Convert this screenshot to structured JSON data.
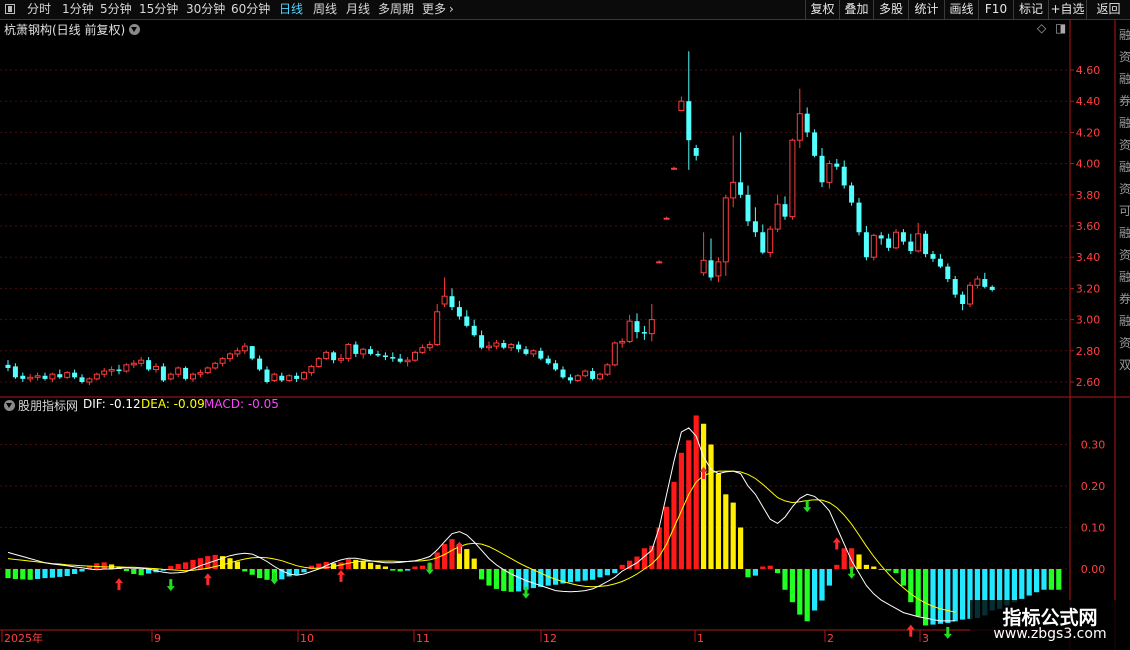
{
  "toolbar": {
    "periods": [
      "分时",
      "1分钟",
      "5分钟",
      "15分钟",
      "30分钟",
      "60分钟",
      "日线",
      "周线",
      "月线",
      "多周期",
      "更多"
    ],
    "active_period": "日线",
    "right_buttons": [
      "复权",
      "叠加",
      "多股",
      "统计",
      "画线",
      "F10",
      "标记",
      "+自选",
      "返回"
    ]
  },
  "main_panel": {
    "title": "杭萧钢构(日线 前复权)",
    "price_ticks": [
      "4.60",
      "4.40",
      "4.20",
      "4.00",
      "3.80",
      "3.60",
      "3.40",
      "3.20",
      "3.00",
      "2.80",
      "2.60"
    ]
  },
  "indicator_panel": {
    "name": "股朋指标网",
    "dif_label": "DIF: -0.12",
    "dea_label": "DEA: -0.09",
    "macd_label": "MACD: -0.05",
    "ticks": [
      "0.30",
      "0.20",
      "0.10",
      "0.00"
    ]
  },
  "x_axis": {
    "labels": [
      "2025年",
      "9",
      "10",
      "11",
      "12",
      "1",
      "2",
      "3"
    ]
  },
  "side_text": [
    "融",
    "资",
    "融",
    "券",
    "融",
    "资",
    "融",
    "资",
    "可",
    "融",
    "资",
    "融",
    "券",
    "融",
    "资",
    "双"
  ],
  "watermark": {
    "title": "指标公式网",
    "url": "www.zbgs3.com"
  },
  "colors": {
    "up": "#ff3c3c",
    "down": "#54ffff",
    "axis": "#b01818",
    "grid": "#4a0e0e",
    "dif": "#ffffff",
    "dea": "#ffff00",
    "macd": "#ff44ff",
    "active": "#4fd4ff"
  },
  "chart_data": {
    "type": "candlestick",
    "title": "杭萧钢构(日线 前复权)",
    "ylim": [
      2.5,
      4.75
    ],
    "candles": [
      [
        2.71,
        2.74,
        2.67,
        2.69
      ],
      [
        2.7,
        2.72,
        2.62,
        2.63
      ],
      [
        2.64,
        2.66,
        2.6,
        2.62
      ],
      [
        2.62,
        2.65,
        2.6,
        2.63
      ],
      [
        2.63,
        2.66,
        2.61,
        2.64
      ],
      [
        2.64,
        2.66,
        2.61,
        2.62
      ],
      [
        2.62,
        2.66,
        2.6,
        2.65
      ],
      [
        2.65,
        2.68,
        2.62,
        2.63
      ],
      [
        2.63,
        2.67,
        2.62,
        2.66
      ],
      [
        2.66,
        2.68,
        2.62,
        2.63
      ],
      [
        2.63,
        2.65,
        2.59,
        2.6
      ],
      [
        2.6,
        2.63,
        2.58,
        2.62
      ],
      [
        2.62,
        2.66,
        2.61,
        2.65
      ],
      [
        2.65,
        2.69,
        2.63,
        2.67
      ],
      [
        2.67,
        2.7,
        2.64,
        2.68
      ],
      [
        2.68,
        2.71,
        2.65,
        2.67
      ],
      [
        2.67,
        2.72,
        2.66,
        2.71
      ],
      [
        2.71,
        2.74,
        2.69,
        2.72
      ],
      [
        2.72,
        2.76,
        2.7,
        2.74
      ],
      [
        2.74,
        2.76,
        2.67,
        2.68
      ],
      [
        2.68,
        2.72,
        2.66,
        2.7
      ],
      [
        2.7,
        2.72,
        2.6,
        2.61
      ],
      [
        2.62,
        2.66,
        2.61,
        2.65
      ],
      [
        2.65,
        2.7,
        2.63,
        2.69
      ],
      [
        2.69,
        2.7,
        2.61,
        2.62
      ],
      [
        2.62,
        2.66,
        2.6,
        2.65
      ],
      [
        2.65,
        2.68,
        2.63,
        2.66
      ],
      [
        2.66,
        2.7,
        2.65,
        2.69
      ],
      [
        2.69,
        2.73,
        2.68,
        2.72
      ],
      [
        2.72,
        2.76,
        2.7,
        2.75
      ],
      [
        2.75,
        2.79,
        2.73,
        2.78
      ],
      [
        2.78,
        2.82,
        2.76,
        2.8
      ],
      [
        2.8,
        2.85,
        2.78,
        2.83
      ],
      [
        2.83,
        2.83,
        2.74,
        2.75
      ],
      [
        2.75,
        2.77,
        2.67,
        2.68
      ],
      [
        2.68,
        2.7,
        2.59,
        2.6
      ],
      [
        2.61,
        2.66,
        2.6,
        2.65
      ],
      [
        2.64,
        2.66,
        2.6,
        2.61
      ],
      [
        2.61,
        2.65,
        2.6,
        2.64
      ],
      [
        2.64,
        2.66,
        2.6,
        2.62
      ],
      [
        2.62,
        2.67,
        2.61,
        2.66
      ],
      [
        2.66,
        2.71,
        2.64,
        2.7
      ],
      [
        2.7,
        2.76,
        2.69,
        2.75
      ],
      [
        2.75,
        2.8,
        2.74,
        2.79
      ],
      [
        2.79,
        2.8,
        2.72,
        2.74
      ],
      [
        2.74,
        2.78,
        2.72,
        2.75
      ],
      [
        2.75,
        2.85,
        2.73,
        2.84
      ],
      [
        2.84,
        2.86,
        2.76,
        2.78
      ],
      [
        2.78,
        2.82,
        2.75,
        2.81
      ],
      [
        2.81,
        2.83,
        2.77,
        2.78
      ],
      [
        2.78,
        2.8,
        2.76,
        2.77
      ],
      [
        2.77,
        2.79,
        2.74,
        2.76
      ],
      [
        2.76,
        2.79,
        2.73,
        2.75
      ],
      [
        2.75,
        2.78,
        2.72,
        2.73
      ],
      [
        2.73,
        2.76,
        2.7,
        2.74
      ],
      [
        2.74,
        2.8,
        2.73,
        2.79
      ],
      [
        2.79,
        2.84,
        2.78,
        2.82
      ],
      [
        2.82,
        2.86,
        2.8,
        2.84
      ],
      [
        2.84,
        3.1,
        2.83,
        3.05
      ],
      [
        3.1,
        3.27,
        3.08,
        3.15
      ],
      [
        3.15,
        3.2,
        3.06,
        3.08
      ],
      [
        3.08,
        3.12,
        3.0,
        3.02
      ],
      [
        3.02,
        3.06,
        2.95,
        2.96
      ],
      [
        2.96,
        3.0,
        2.89,
        2.9
      ],
      [
        2.9,
        2.93,
        2.81,
        2.82
      ],
      [
        2.82,
        2.86,
        2.8,
        2.83
      ],
      [
        2.83,
        2.87,
        2.81,
        2.85
      ],
      [
        2.85,
        2.87,
        2.81,
        2.82
      ],
      [
        2.82,
        2.85,
        2.8,
        2.84
      ],
      [
        2.84,
        2.86,
        2.79,
        2.81
      ],
      [
        2.81,
        2.83,
        2.77,
        2.78
      ],
      [
        2.78,
        2.81,
        2.76,
        2.8
      ],
      [
        2.8,
        2.82,
        2.74,
        2.75
      ],
      [
        2.75,
        2.77,
        2.71,
        2.72
      ],
      [
        2.72,
        2.74,
        2.67,
        2.68
      ],
      [
        2.68,
        2.7,
        2.62,
        2.63
      ],
      [
        2.63,
        2.65,
        2.59,
        2.61
      ],
      [
        2.61,
        2.65,
        2.6,
        2.64
      ],
      [
        2.64,
        2.68,
        2.63,
        2.67
      ],
      [
        2.67,
        2.69,
        2.61,
        2.62
      ],
      [
        2.62,
        2.66,
        2.61,
        2.65
      ],
      [
        2.65,
        2.72,
        2.64,
        2.71
      ],
      [
        2.71,
        2.86,
        2.7,
        2.85
      ],
      [
        2.85,
        2.88,
        2.82,
        2.86
      ],
      [
        2.86,
        3.03,
        2.85,
        2.99
      ],
      [
        2.99,
        3.04,
        2.88,
        2.92
      ],
      [
        2.92,
        2.96,
        2.87,
        2.91
      ],
      [
        2.91,
        3.1,
        2.86,
        3.0
      ],
      [
        3.37,
        3.38,
        3.36,
        3.37
      ],
      [
        3.65,
        3.66,
        3.64,
        3.65
      ],
      [
        3.97,
        3.98,
        3.96,
        3.97
      ],
      [
        4.34,
        4.43,
        4.34,
        4.4
      ],
      [
        4.4,
        4.72,
        3.96,
        4.15
      ],
      [
        4.1,
        4.12,
        4.02,
        4.05
      ],
      [
        3.3,
        3.56,
        3.28,
        3.38
      ],
      [
        3.38,
        3.52,
        3.25,
        3.27
      ],
      [
        3.28,
        3.4,
        3.24,
        3.37
      ],
      [
        3.37,
        3.8,
        3.28,
        3.78
      ],
      [
        3.78,
        4.18,
        3.72,
        3.88
      ],
      [
        3.88,
        4.2,
        3.78,
        3.8
      ],
      [
        3.8,
        3.86,
        3.6,
        3.63
      ],
      [
        3.63,
        3.72,
        3.53,
        3.56
      ],
      [
        3.56,
        3.61,
        3.42,
        3.43
      ],
      [
        3.43,
        3.6,
        3.4,
        3.58
      ],
      [
        3.58,
        3.8,
        3.56,
        3.74
      ],
      [
        3.74,
        3.79,
        3.64,
        3.66
      ],
      [
        3.66,
        4.16,
        3.64,
        4.15
      ],
      [
        4.15,
        4.48,
        4.1,
        4.32
      ],
      [
        4.32,
        4.36,
        4.17,
        4.2
      ],
      [
        4.2,
        4.22,
        4.04,
        4.05
      ],
      [
        4.05,
        4.1,
        3.85,
        3.88
      ],
      [
        3.88,
        4.02,
        3.84,
        4.0
      ],
      [
        4.0,
        4.03,
        3.96,
        3.98
      ],
      [
        3.98,
        4.02,
        3.84,
        3.86
      ],
      [
        3.86,
        3.88,
        3.73,
        3.75
      ],
      [
        3.75,
        3.78,
        3.54,
        3.56
      ],
      [
        3.56,
        3.6,
        3.38,
        3.4
      ],
      [
        3.4,
        3.55,
        3.38,
        3.54
      ],
      [
        3.54,
        3.56,
        3.48,
        3.52
      ],
      [
        3.52,
        3.55,
        3.44,
        3.46
      ],
      [
        3.46,
        3.58,
        3.45,
        3.56
      ],
      [
        3.56,
        3.58,
        3.48,
        3.5
      ],
      [
        3.5,
        3.55,
        3.42,
        3.44
      ],
      [
        3.44,
        3.62,
        3.43,
        3.55
      ],
      [
        3.55,
        3.57,
        3.4,
        3.42
      ],
      [
        3.42,
        3.44,
        3.37,
        3.39
      ],
      [
        3.39,
        3.42,
        3.33,
        3.34
      ],
      [
        3.34,
        3.36,
        3.24,
        3.26
      ],
      [
        3.26,
        3.28,
        3.14,
        3.16
      ],
      [
        3.16,
        3.18,
        3.06,
        3.1
      ],
      [
        3.1,
        3.24,
        3.08,
        3.22
      ],
      [
        3.22,
        3.28,
        3.2,
        3.26
      ],
      [
        3.26,
        3.3,
        3.2,
        3.21
      ],
      [
        3.21,
        3.22,
        3.18,
        3.19
      ]
    ],
    "macd": [
      -0.022,
      -0.024,
      -0.025,
      -0.026,
      -0.024,
      -0.022,
      -0.021,
      -0.019,
      -0.017,
      -0.012,
      -0.006,
      0.008,
      0.014,
      0.016,
      0.011,
      0.006,
      -0.005,
      -0.012,
      -0.015,
      -0.011,
      -0.008,
      -0.004,
      0.007,
      0.012,
      0.016,
      0.022,
      0.026,
      0.031,
      0.034,
      0.031,
      0.026,
      0.018,
      -0.006,
      -0.014,
      -0.022,
      -0.026,
      -0.028,
      -0.025,
      -0.018,
      -0.014,
      -0.008,
      0.008,
      0.013,
      0.017,
      0.014,
      0.016,
      0.024,
      0.022,
      0.02,
      0.015,
      0.01,
      0.006,
      -0.004,
      -0.006,
      -0.004,
      0.006,
      0.008,
      0.014,
      0.04,
      0.06,
      0.072,
      0.06,
      0.048,
      0.025,
      -0.025,
      -0.04,
      -0.048,
      -0.053,
      -0.055,
      -0.054,
      -0.05,
      -0.046,
      -0.043,
      -0.04,
      -0.038,
      -0.035,
      -0.032,
      -0.03,
      -0.028,
      -0.026,
      -0.02,
      -0.015,
      -0.01,
      0.01,
      0.02,
      0.03,
      0.05,
      0.056,
      0.1,
      0.15,
      0.21,
      0.28,
      0.31,
      0.37,
      0.35,
      0.3,
      0.23,
      0.18,
      0.16,
      0.1,
      -0.02,
      -0.016,
      0.006,
      0.008,
      -0.01,
      -0.05,
      -0.08,
      -0.11,
      -0.126,
      -0.1,
      -0.076,
      -0.04,
      0.01,
      0.05,
      0.05,
      0.035,
      0.01,
      0.006,
      -0.002,
      -0.004,
      -0.01,
      -0.04,
      -0.08,
      -0.114,
      -0.136,
      -0.134,
      -0.132,
      -0.13,
      -0.126,
      -0.122,
      -0.12,
      -0.118,
      -0.112,
      -0.1,
      -0.096,
      -0.088,
      -0.08,
      -0.072,
      -0.064,
      -0.056,
      -0.05,
      -0.05,
      -0.05
    ],
    "dif": [
      0.04,
      0.035,
      0.03,
      0.025,
      0.02,
      0.015,
      0.012,
      0.01,
      0.008,
      0.005,
      0.003,
      0.0,
      -0.002,
      0.0,
      0.0,
      0.002,
      0.003,
      0.002,
      0.002,
      0.0,
      -0.004,
      -0.008,
      -0.01,
      -0.009,
      -0.007,
      0.0,
      0.008,
      0.014,
      0.02,
      0.026,
      0.032,
      0.036,
      0.038,
      0.036,
      0.028,
      0.018,
      0.006,
      -0.004,
      -0.012,
      -0.015,
      -0.012,
      -0.006,
      0.0,
      0.008,
      0.016,
      0.022,
      0.026,
      0.026,
      0.023,
      0.02,
      0.017,
      0.015,
      0.015,
      0.016,
      0.018,
      0.02,
      0.024,
      0.03,
      0.046,
      0.066,
      0.085,
      0.09,
      0.082,
      0.065,
      0.045,
      0.025,
      0.01,
      -0.002,
      -0.012,
      -0.02,
      -0.028,
      -0.034,
      -0.04,
      -0.046,
      -0.052,
      -0.054,
      -0.055,
      -0.054,
      -0.052,
      -0.048,
      -0.04,
      -0.03,
      -0.02,
      -0.005,
      0.005,
      0.015,
      0.03,
      0.045,
      0.1,
      0.18,
      0.26,
      0.33,
      0.34,
      0.32,
      0.27,
      0.24,
      0.23,
      0.234,
      0.236,
      0.23,
      0.2,
      0.18,
      0.15,
      0.12,
      0.11,
      0.125,
      0.15,
      0.17,
      0.18,
      0.175,
      0.16,
      0.14,
      0.1,
      0.06,
      0.02,
      -0.01,
      -0.04,
      -0.06,
      -0.075,
      -0.085,
      -0.095,
      -0.105,
      -0.11,
      -0.115,
      -0.118,
      -0.122,
      -0.125,
      -0.125,
      -0.125
    ],
    "dea": [
      0.025,
      0.023,
      0.021,
      0.019,
      0.017,
      0.015,
      0.013,
      0.012,
      0.01,
      0.009,
      0.008,
      0.007,
      0.006,
      0.005,
      0.005,
      0.005,
      0.004,
      0.004,
      0.003,
      0.002,
      0.001,
      -0.001,
      -0.002,
      -0.003,
      -0.004,
      -0.003,
      -0.001,
      0.002,
      0.006,
      0.01,
      0.015,
      0.02,
      0.024,
      0.027,
      0.028,
      0.027,
      0.024,
      0.02,
      0.014,
      0.008,
      0.004,
      0.002,
      0.002,
      0.003,
      0.006,
      0.01,
      0.014,
      0.017,
      0.019,
      0.019,
      0.019,
      0.019,
      0.019,
      0.018,
      0.018,
      0.019,
      0.02,
      0.022,
      0.027,
      0.035,
      0.045,
      0.054,
      0.06,
      0.062,
      0.06,
      0.054,
      0.045,
      0.035,
      0.025,
      0.015,
      0.006,
      -0.002,
      -0.01,
      -0.018,
      -0.025,
      -0.03,
      -0.035,
      -0.039,
      -0.042,
      -0.043,
      -0.042,
      -0.04,
      -0.036,
      -0.03,
      -0.022,
      -0.012,
      0.0,
      0.012,
      0.03,
      0.06,
      0.1,
      0.14,
      0.18,
      0.21,
      0.225,
      0.232,
      0.236,
      0.236,
      0.236,
      0.234,
      0.228,
      0.218,
      0.204,
      0.188,
      0.172,
      0.164,
      0.16,
      0.162,
      0.165,
      0.167,
      0.166,
      0.16,
      0.148,
      0.13,
      0.108,
      0.082,
      0.055,
      0.03,
      0.008,
      -0.012,
      -0.03,
      -0.045,
      -0.06,
      -0.072,
      -0.082,
      -0.09,
      -0.096,
      -0.1,
      -0.104
    ],
    "signals": [
      {
        "i": 15,
        "type": "buy"
      },
      {
        "i": 22,
        "type": "sell"
      },
      {
        "i": 27,
        "type": "buy"
      },
      {
        "i": 36,
        "type": "sell"
      },
      {
        "i": 45,
        "type": "buy"
      },
      {
        "i": 57,
        "type": "sell"
      },
      {
        "i": 61,
        "type": "buy"
      },
      {
        "i": 70,
        "type": "sell"
      },
      {
        "i": 94,
        "type": "buy"
      },
      {
        "i": 108,
        "type": "sell"
      },
      {
        "i": 112,
        "type": "buy"
      },
      {
        "i": 114,
        "type": "sell"
      },
      {
        "i": 122,
        "type": "buy"
      },
      {
        "i": 127,
        "type": "sell"
      }
    ]
  }
}
